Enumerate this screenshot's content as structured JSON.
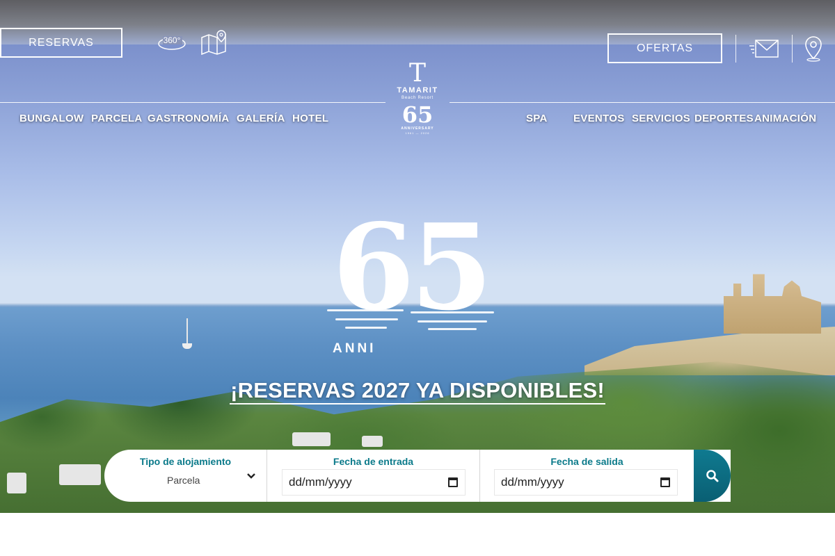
{
  "header": {
    "reservas_label": "RESERVAS",
    "ofertas_label": "OFERTAS",
    "icon_360_label": "360°"
  },
  "logo": {
    "letter": "T",
    "name": "TAMARIT",
    "subtitle": "Beach Resort",
    "number": "65",
    "anniversary": "ANNIVERSARY",
    "years": "1961 — 2026"
  },
  "nav": {
    "left": [
      "BUNGALOW",
      "PARCELA",
      "GASTRONOMÍA",
      "GALERÍA",
      "HOTEL"
    ],
    "right": [
      "SPA",
      "EVENTOS",
      "SERVICIOS",
      "DEPORTES",
      "ANIMACIÓN"
    ]
  },
  "hero": {
    "big_number": "65",
    "anniversary_partial": "ANNI",
    "headline": "¡RESERVAS 2027 YA DISPONIBLES!"
  },
  "booking": {
    "type_label": "Tipo de alojamiento",
    "type_value": "Parcela",
    "checkin_label": "Fecha de entrada",
    "checkin_placeholder": "dd/mm/yyyy",
    "checkout_label": "Fecha de salida",
    "checkout_placeholder": "dd/mm/yyyy"
  },
  "icons": {
    "tour": "360-icon",
    "map": "map-icon",
    "mail": "mail-icon",
    "location": "location-pin-icon",
    "search": "search-icon",
    "dropdown": "chevron-down-icon"
  },
  "colors": {
    "accent": "#0b7a8a",
    "search_button": "#0a5f73",
    "white": "#ffffff"
  }
}
